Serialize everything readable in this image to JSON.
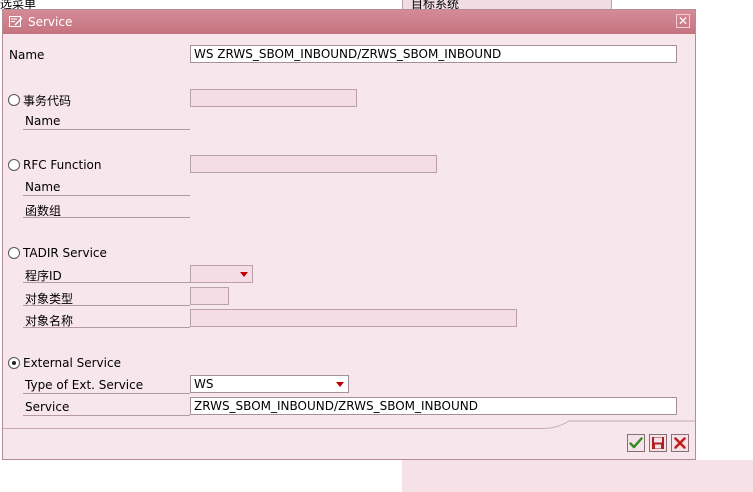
{
  "background": {
    "left_partial_text": "选菜单",
    "right_partial_text": "目标系统"
  },
  "dialog": {
    "title": "Service",
    "close_symbol": "✕",
    "name": {
      "label": "Name",
      "value": "WS ZRWS_SBOM_INBOUND/ZRWS_SBOM_INBOUND"
    },
    "transaction": {
      "label": "事务代码",
      "value": "",
      "sub": {
        "name_label": "Name"
      }
    },
    "rfc": {
      "label": "RFC Function",
      "value": "",
      "sub": {
        "name_label": "Name",
        "group_label": "函数组"
      }
    },
    "tadir": {
      "label": "TADIR Service",
      "program_id_label": "程序ID",
      "program_id_value": "",
      "object_type_label": "对象类型",
      "object_type_value": "",
      "object_name_label": "对象名称",
      "object_name_value": ""
    },
    "external": {
      "label": "External Service",
      "selected": true,
      "type_label": "Type of Ext. Service",
      "type_value": "WS",
      "service_label": "Service",
      "service_value": "ZRWS_SBOM_INBOUND/ZRWS_SBOM_INBOUND"
    },
    "buttons": {
      "confirm_icon": "checkmark-icon",
      "save_icon": "save-icon",
      "cancel_icon": "cancel-icon"
    },
    "colors": {
      "title_bar": "#c6747f",
      "dialog_bg": "#f7e6ec",
      "disabled_field": "#f6dde5"
    }
  }
}
